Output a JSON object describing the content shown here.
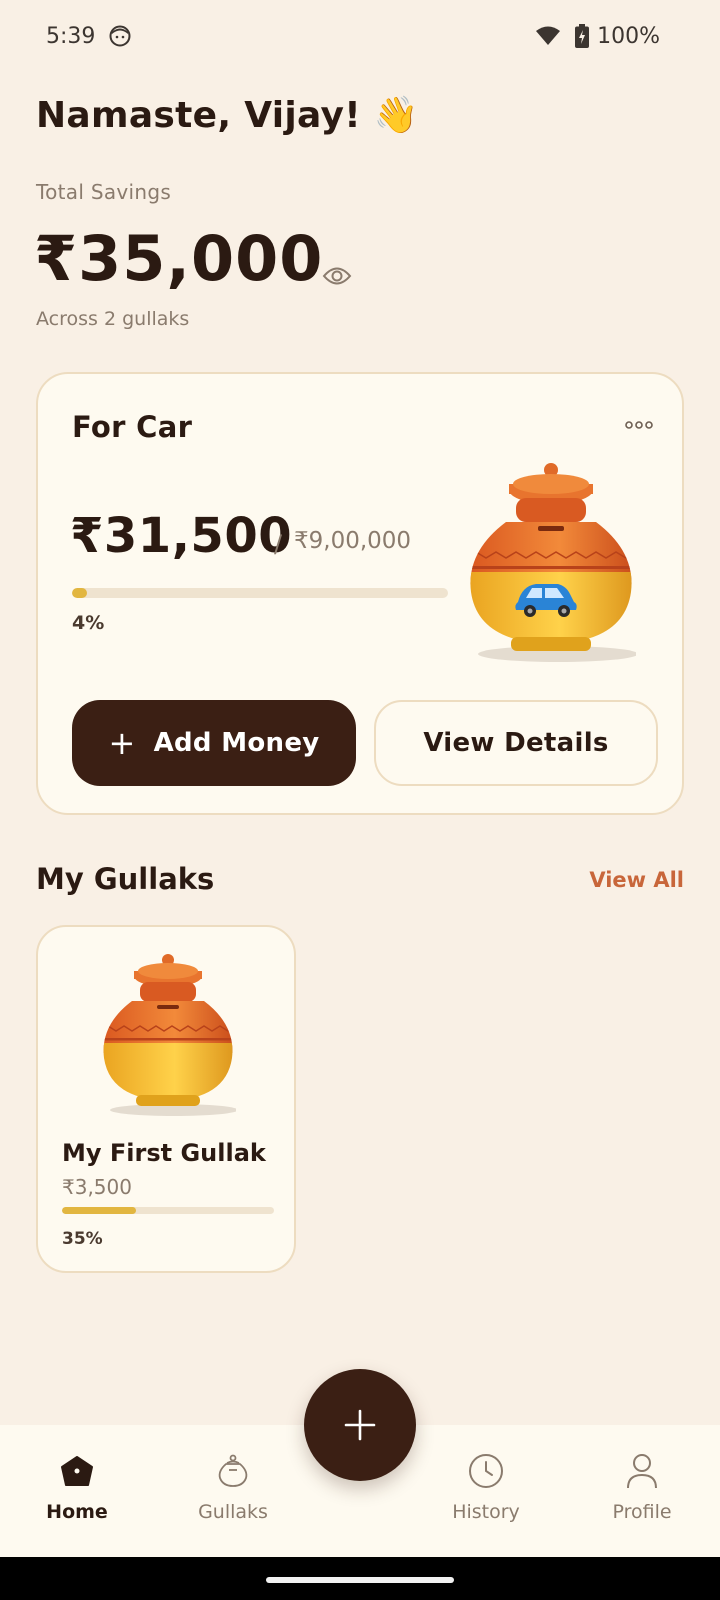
{
  "status_bar": {
    "time": "5:39",
    "battery": "100%",
    "icons": [
      "face-notification-icon",
      "wifi-icon",
      "battery-charging-icon"
    ]
  },
  "header": {
    "greeting": "Namaste, Vijay! 👋",
    "total_label": "Total Savings",
    "total_amount": "₹35,000",
    "across": "Across 2 gullaks"
  },
  "goal_card": {
    "title": "For Car",
    "saved": "₹31,500",
    "separator": "/",
    "target": "₹9,00,000",
    "progress_percent": 4,
    "progress_label": "4%",
    "add_money_label": "Add Money",
    "view_details_label": "View Details",
    "pot_badge_icon": "car-icon"
  },
  "gullaks_section": {
    "title": "My Gullaks",
    "view_all": "View All",
    "items": [
      {
        "name": "My First Gullak",
        "amount": "₹3,500",
        "progress_percent": 35,
        "progress_label": "35%"
      }
    ]
  },
  "bottom_nav": {
    "items": [
      {
        "label": "Home",
        "icon": "home-icon",
        "active": true
      },
      {
        "label": "Gullaks",
        "icon": "gullak-icon",
        "active": false
      },
      {
        "label": "History",
        "icon": "clock-icon",
        "active": false
      },
      {
        "label": "Profile",
        "icon": "person-icon",
        "active": false
      }
    ]
  },
  "colors": {
    "background": "#f9f0e5",
    "card": "#fefaf0",
    "primary_dark": "#3b1f14",
    "accent_orange": "#c8663a",
    "progress_fill": "#e2b640",
    "muted_text": "#8a7b6d"
  }
}
